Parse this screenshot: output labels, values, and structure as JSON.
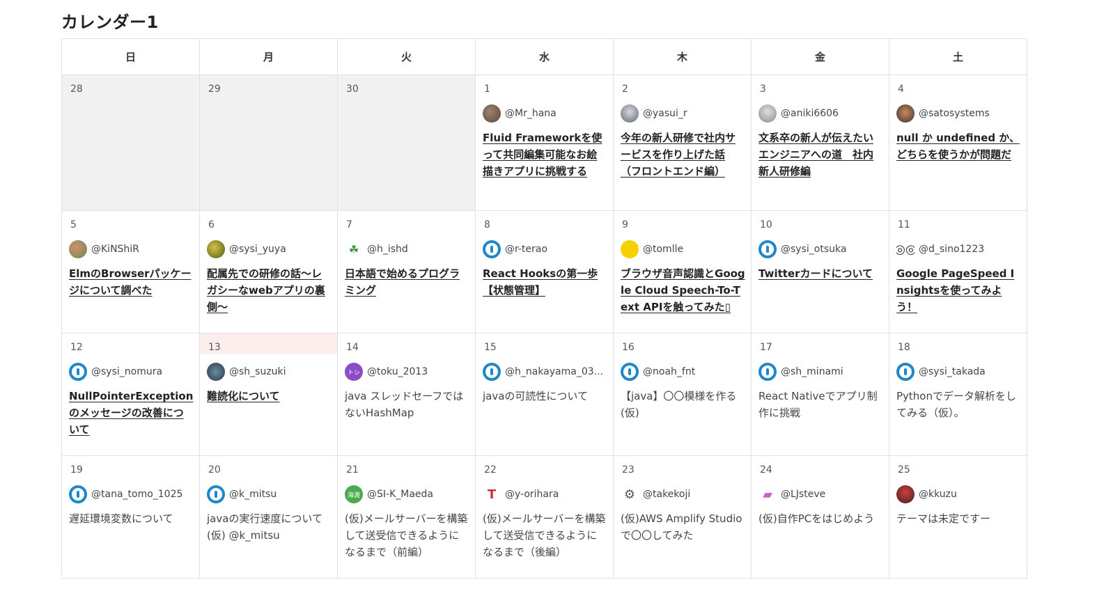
{
  "calendar": {
    "title": "カレンダー1",
    "weekdays": [
      "日",
      "月",
      "火",
      "水",
      "木",
      "金",
      "土"
    ],
    "weeks": [
      [
        {
          "day": "28",
          "other": true
        },
        {
          "day": "29",
          "other": true
        },
        {
          "day": "30",
          "other": true
        },
        {
          "day": "1",
          "user": "@Mr_hana",
          "avatar": "photo1",
          "article": "Fluid Frameworkを使って共同編集可能なお絵描きアプリに挑戦する",
          "linked": true
        },
        {
          "day": "2",
          "user": "@yasui_r",
          "avatar": "photo2",
          "article": "今年の新人研修で社内サービスを作り上げた話（フロントエンド編）",
          "linked": true
        },
        {
          "day": "3",
          "user": "@aniki6606",
          "avatar": "photo3",
          "article": "文系卒の新人が伝えたいエンジニアへの道　社内新人研修編",
          "linked": true
        },
        {
          "day": "4",
          "user": "@satosystems",
          "avatar": "photo4",
          "article": "null か undefined か、どちらを使うかが問題だ",
          "linked": true
        }
      ],
      [
        {
          "day": "5",
          "user": "@KiNShiR",
          "avatar": "photo5",
          "article": "ElmのBrowserパッケージについて調べた",
          "linked": true
        },
        {
          "day": "6",
          "user": "@sysi_yuya",
          "avatar": "photo6",
          "article": "配属先での研修の話～レガシーなwebアプリの裏側～",
          "linked": true
        },
        {
          "day": "7",
          "user": "@h_ishd",
          "avatar": "leaf",
          "article": "日本語で始めるプログラミング",
          "linked": true
        },
        {
          "day": "8",
          "user": "@r-terao",
          "avatar": "qiita",
          "article": "React Hooksの第一歩【状態管理】",
          "linked": true
        },
        {
          "day": "9",
          "user": "@tomlle",
          "avatar": "yellow",
          "article": "ブラウザ音声認識とGoogle Cloud Speech-To-Text APIを触ってみた▯",
          "linked": true
        },
        {
          "day": "10",
          "user": "@sysi_otsuka",
          "avatar": "qiita",
          "article": "Twitterカードについて",
          "linked": true
        },
        {
          "day": "11",
          "user": "@d_sino1223",
          "avatar": "glasses",
          "article": "Google PageSpeed Insightsを使ってみよう！",
          "linked": true
        }
      ],
      [
        {
          "day": "12",
          "user": "@sysi_nomura",
          "avatar": "qiita",
          "article": "NullPointerExceptionのメッセージの改善について",
          "linked": true
        },
        {
          "day": "13",
          "today": true,
          "user": "@sh_suzuki",
          "avatar": "photo7",
          "article": "難読化について",
          "linked": true
        },
        {
          "day": "14",
          "user": "@toku_2013",
          "avatar": "toku",
          "avatar_text": "トシ",
          "article": "java スレッドセーフではないHashMap",
          "linked": false
        },
        {
          "day": "15",
          "user": "@h_nakayama_03...",
          "avatar": "qiita",
          "article": "javaの可読性について",
          "linked": false
        },
        {
          "day": "16",
          "user": "@noah_fnt",
          "avatar": "qiita",
          "article": "【java】〇〇模様を作る(仮)",
          "linked": false
        },
        {
          "day": "17",
          "user": "@sh_minami",
          "avatar": "qiita",
          "article": "React Nativeでアプリ制作に挑戦",
          "linked": false
        },
        {
          "day": "18",
          "user": "@sysi_takada",
          "avatar": "qiita",
          "article": "Pythonでデータ解析をしてみる（仮）。",
          "linked": false
        }
      ],
      [
        {
          "day": "19",
          "user": "@tana_tomo_1025",
          "avatar": "qiita",
          "article": "遅延環境変数について",
          "linked": false
        },
        {
          "day": "20",
          "user": "@k_mitsu",
          "avatar": "qiita",
          "article": "javaの実行速度について(仮) @k_mitsu",
          "linked": false
        },
        {
          "day": "21",
          "user": "@SI-K_Maeda",
          "avatar": "green",
          "avatar_text": "海渡",
          "article": "(仮)メールサーバーを構築して送受信できるようになるまで（前編）",
          "linked": false
        },
        {
          "day": "22",
          "user": "@y-orihara",
          "avatar": "red",
          "article": "(仮)メールサーバーを構築して送受信できるようになるまで（後編）",
          "linked": false
        },
        {
          "day": "23",
          "user": "@takekoji",
          "avatar": "robot",
          "article": "(仮)AWS Amplify Studioで〇〇してみた",
          "linked": false
        },
        {
          "day": "24",
          "user": "@LJsteve",
          "avatar": "pink",
          "article": "(仮)自作PCをはじめよう",
          "linked": false
        },
        {
          "day": "25",
          "user": "@kkuzu",
          "avatar": "photo8",
          "article": "テーマは未定ですー",
          "linked": false
        }
      ]
    ]
  }
}
